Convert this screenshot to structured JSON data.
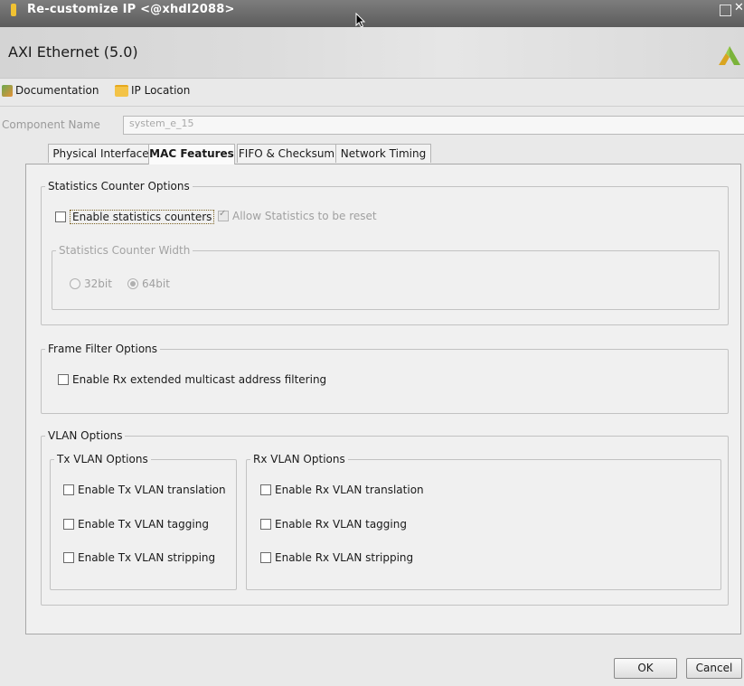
{
  "window": {
    "title": "Re-customize IP <@xhdl2088>"
  },
  "header": {
    "ip_title": "AXI Ethernet (5.0)"
  },
  "links": {
    "documentation": "Documentation",
    "ip_location": "IP Location"
  },
  "component": {
    "label": "Component Name",
    "value": "system_e_15"
  },
  "tabs": [
    {
      "label": "Physical Interface"
    },
    {
      "label": "MAC Features"
    },
    {
      "label": "FIFO & Checksum"
    },
    {
      "label": "Network Timing"
    }
  ],
  "statistics": {
    "legend": "Statistics Counter Options",
    "enable_label": "Enable statistics counters",
    "reset_label": "Allow Statistics to be reset",
    "width_legend": "Statistics Counter Width",
    "opt_32": "32bit",
    "opt_64": "64bit",
    "selected_width": "64bit"
  },
  "frame_filter": {
    "legend": "Frame Filter Options",
    "multicast_label": "Enable Rx extended multicast address filtering"
  },
  "vlan": {
    "legend": "VLAN Options",
    "tx": {
      "legend": "Tx VLAN Options",
      "translation": "Enable Tx VLAN translation",
      "tagging": "Enable Tx VLAN tagging",
      "stripping": "Enable Tx VLAN stripping"
    },
    "rx": {
      "legend": "Rx VLAN Options",
      "translation": "Enable Rx VLAN translation",
      "tagging": "Enable Rx VLAN tagging",
      "stripping": "Enable Rx VLAN stripping"
    }
  },
  "buttons": {
    "ok": "OK",
    "cancel": "Cancel"
  },
  "colors": {
    "title_bar": "#6b6b6b",
    "panel_bg": "#f0f0f0",
    "accent": "#f1c232"
  }
}
